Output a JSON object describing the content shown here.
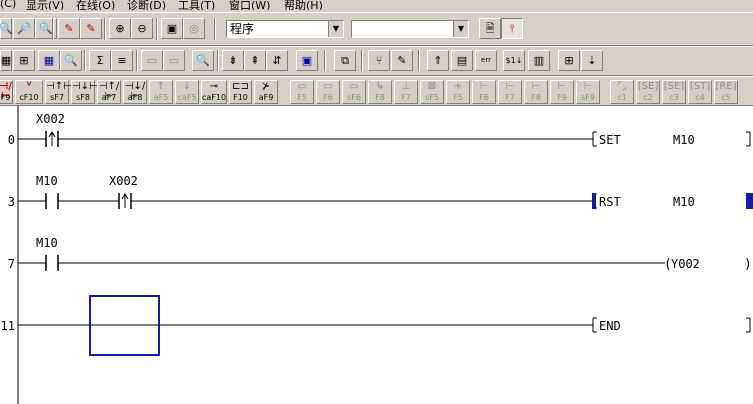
{
  "menu": [
    {
      "label": "(C)"
    },
    {
      "label": "显示(V)"
    },
    {
      "label": "在线(O)"
    },
    {
      "label": "诊断(D)"
    },
    {
      "label": "工具(T)"
    },
    {
      "label": "窗口(W)"
    },
    {
      "label": "帮助(H)"
    }
  ],
  "toolbar": {
    "program_combo": "程序",
    "second_combo": ""
  },
  "keys": [
    {
      "sym": "⊣/⊢",
      "label": "F9",
      "state": "red"
    },
    {
      "sym": "ⱽ",
      "label": "cF10",
      "state": "red"
    },
    {
      "sym": "⊣↑⊢",
      "label": "sF7",
      "state": "normal"
    },
    {
      "sym": "⊣↓⊢",
      "label": "sF8",
      "state": "normal"
    },
    {
      "sym": "⊣↑/⊢",
      "label": "aF7",
      "state": "normal"
    },
    {
      "sym": "⊣↓/⊢",
      "label": "aF8",
      "state": "normal"
    },
    {
      "sym": "↑",
      "label": "aF5",
      "state": "dis"
    },
    {
      "sym": "↓",
      "label": "caF5",
      "state": "dis"
    },
    {
      "sym": "⊸",
      "label": "caF10",
      "state": "normal"
    },
    {
      "sym": "⊏⊐",
      "label": "F10",
      "state": "normal"
    },
    {
      "sym": "⊁",
      "label": "aF9",
      "state": "normal"
    },
    {
      "sym": "▭",
      "label": "F5",
      "state": "dis"
    },
    {
      "sym": "▭",
      "label": "F6",
      "state": "dis"
    },
    {
      "sym": "▭",
      "label": "sF6",
      "state": "dis"
    },
    {
      "sym": "↳",
      "label": "F8",
      "state": "dis"
    },
    {
      "sym": "⊥",
      "label": "F7",
      "state": "dis"
    },
    {
      "sym": "⊠",
      "label": "sF5",
      "state": "dis"
    },
    {
      "sym": "+",
      "label": "F5",
      "state": "dis"
    },
    {
      "sym": "⊢",
      "label": "F6",
      "state": "dis"
    },
    {
      "sym": "⊢",
      "label": "F7",
      "state": "dis"
    },
    {
      "sym": "⊢",
      "label": "F8",
      "state": "dis"
    },
    {
      "sym": "⊢",
      "label": "F9",
      "state": "dis"
    },
    {
      "sym": "⊢",
      "label": "sF9",
      "state": "dis"
    },
    {
      "sym": "⌜⌟",
      "label": "c1",
      "state": "dis"
    },
    {
      "sym": "[SE]",
      "label": "c2",
      "state": "dis"
    },
    {
      "sym": "[SE]",
      "label": "c3",
      "state": "dis"
    },
    {
      "sym": "[ST]",
      "label": "c4",
      "state": "dis"
    },
    {
      "sym": "[RE]",
      "label": "c5",
      "state": "dis"
    }
  ],
  "ladder": {
    "rungs": [
      {
        "step": "0",
        "contacts": [
          {
            "device": "X002",
            "type": "rising"
          }
        ],
        "instruction": {
          "open": "[",
          "op": "SET",
          "operand": "M10",
          "close": "]"
        }
      },
      {
        "step": "3",
        "contacts": [
          {
            "device": "M10",
            "type": "no"
          },
          {
            "device": "X002",
            "type": "rising"
          }
        ],
        "instruction": {
          "open": "[",
          "op": "RST",
          "operand": "M10",
          "close": ""
        }
      },
      {
        "step": "7",
        "contacts": [
          {
            "device": "M10",
            "type": "no"
          }
        ],
        "instruction": {
          "open": "(",
          "op": "Y002",
          "operand": "",
          "close": ")"
        }
      },
      {
        "step": "11",
        "contacts": [],
        "instruction": {
          "open": "[",
          "op": "END",
          "operand": "",
          "close": "]"
        }
      }
    ]
  },
  "colors": {
    "cursor": "#1a1aa0",
    "toolbar_bg": "#d4d0c8"
  }
}
